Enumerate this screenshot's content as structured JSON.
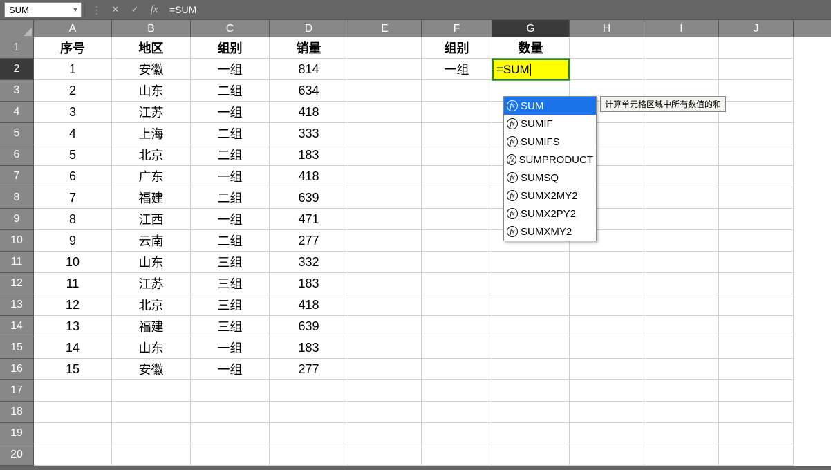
{
  "name_box": "SUM",
  "formula_text": "=SUM",
  "columns": [
    "A",
    "B",
    "C",
    "D",
    "E",
    "F",
    "G",
    "H",
    "I",
    "J"
  ],
  "active_col_index": 6,
  "active_row_index": 1,
  "row_headers": [
    "1",
    "2",
    "3",
    "4",
    "5",
    "6",
    "7",
    "8",
    "9",
    "10",
    "11",
    "12",
    "13",
    "14",
    "15",
    "16",
    "17",
    "18",
    "19",
    "20"
  ],
  "headers_row": {
    "A": "序号",
    "B": "地区",
    "C": "组别",
    "D": "销量",
    "F": "组别",
    "G": "数量"
  },
  "data_rows": [
    {
      "A": "1",
      "B": "安徽",
      "C": "一组",
      "D": "814",
      "F": "一组",
      "G_edit": "=SUM"
    },
    {
      "A": "2",
      "B": "山东",
      "C": "二组",
      "D": "634"
    },
    {
      "A": "3",
      "B": "江苏",
      "C": "一组",
      "D": "418"
    },
    {
      "A": "4",
      "B": "上海",
      "C": "二组",
      "D": "333"
    },
    {
      "A": "5",
      "B": "北京",
      "C": "二组",
      "D": "183"
    },
    {
      "A": "6",
      "B": "广东",
      "C": "一组",
      "D": "418"
    },
    {
      "A": "7",
      "B": "福建",
      "C": "二组",
      "D": "639"
    },
    {
      "A": "8",
      "B": "江西",
      "C": "一组",
      "D": "471"
    },
    {
      "A": "9",
      "B": "云南",
      "C": "二组",
      "D": "277"
    },
    {
      "A": "10",
      "B": "山东",
      "C": "三组",
      "D": "332"
    },
    {
      "A": "11",
      "B": "江苏",
      "C": "三组",
      "D": "183"
    },
    {
      "A": "12",
      "B": "北京",
      "C": "三组",
      "D": "418"
    },
    {
      "A": "13",
      "B": "福建",
      "C": "三组",
      "D": "639"
    },
    {
      "A": "14",
      "B": "山东",
      "C": "一组",
      "D": "183"
    },
    {
      "A": "15",
      "B": "安徽",
      "C": "一组",
      "D": "277"
    }
  ],
  "intellisense": {
    "items": [
      "SUM",
      "SUMIF",
      "SUMIFS",
      "SUMPRODUCT",
      "SUMSQ",
      "SUMX2MY2",
      "SUMX2PY2",
      "SUMXMY2"
    ],
    "selected_index": 0
  },
  "tooltip": "计算单元格区域中所有数值的和",
  "fx_label": "fx",
  "cancel_glyph": "✕",
  "confirm_glyph": "✓",
  "dropdown_glyph": "▼",
  "vdots": "⋮"
}
